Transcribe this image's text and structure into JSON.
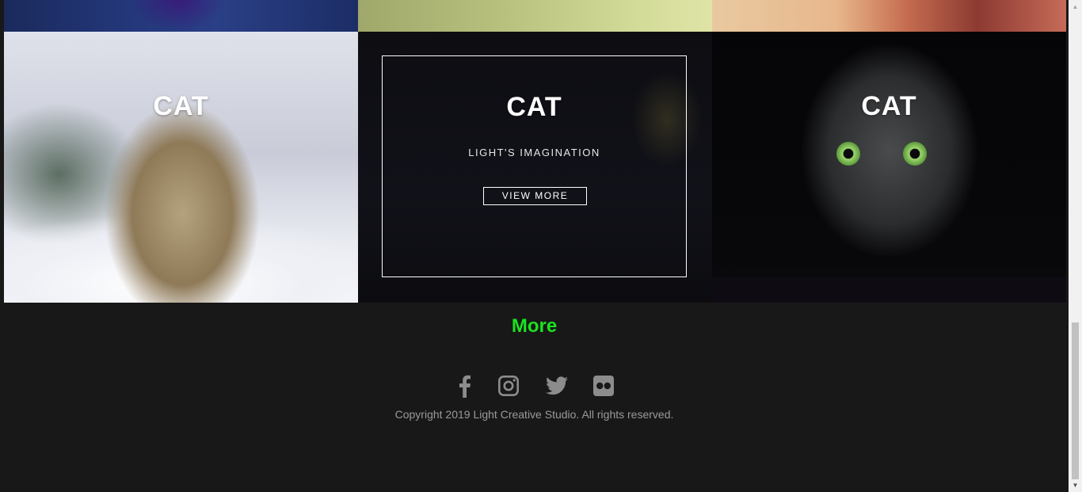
{
  "gallery": {
    "tiles": [
      {
        "title": "CAT"
      },
      {
        "title": "CAT",
        "subtitle": "LIGHT'S IMAGINATION",
        "button": "VIEW MORE"
      },
      {
        "title": "CAT"
      }
    ]
  },
  "footer": {
    "more_label": "More",
    "more_color": "#1be31e",
    "socials": [
      "facebook-icon",
      "instagram-icon",
      "twitter-icon",
      "flickr-icon"
    ],
    "copyright": "Copyright 2019 Light Creative Studio. All rights reserved."
  },
  "scrollbar": {
    "up_arrow": "▲",
    "down_arrow": "▼"
  }
}
